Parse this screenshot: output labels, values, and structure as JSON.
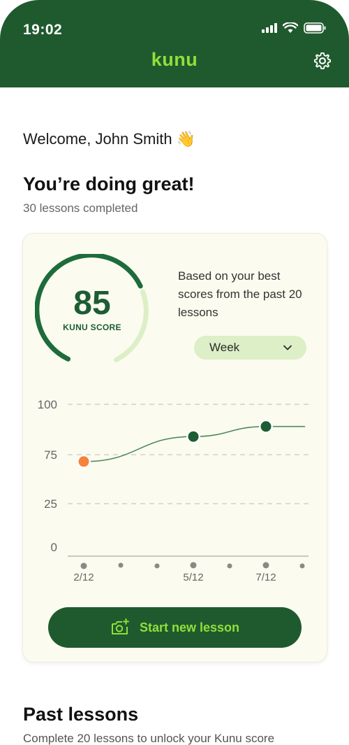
{
  "status_bar": {
    "time": "19:02"
  },
  "header": {
    "brand": "kunu"
  },
  "welcome": {
    "text": "Welcome, John Smith",
    "emoji": "👋"
  },
  "progress": {
    "heading": "You’re doing great!",
    "lessons_completed": "30 lessons completed"
  },
  "score_card": {
    "score": "85",
    "score_label": "KUNU SCORE",
    "description": "Based on your best scores from the past 20 lessons",
    "period_dropdown": {
      "selected": "Week"
    },
    "accent_dark": "#1e5c34",
    "accent_light": "#dcefc6",
    "highlight_orange": "#f5843a"
  },
  "chart_data": {
    "type": "line",
    "y_ticks": [
      "100",
      "75",
      "25",
      "0"
    ],
    "x_labels": [
      "2/12",
      "",
      "",
      "5/12",
      "",
      "7/12",
      ""
    ],
    "points": [
      {
        "x": "2/12",
        "y": 68,
        "highlight": true
      },
      {
        "x": "5/12",
        "y": 84,
        "highlight": false
      },
      {
        "x": "7/12",
        "y": 89,
        "highlight": false
      }
    ],
    "grid": true
  },
  "actions": {
    "start_lesson": "Start new lesson"
  },
  "past_lessons": {
    "title": "Past lessons",
    "subtitle": "Complete 20 lessons to unlock your Kunu score"
  }
}
